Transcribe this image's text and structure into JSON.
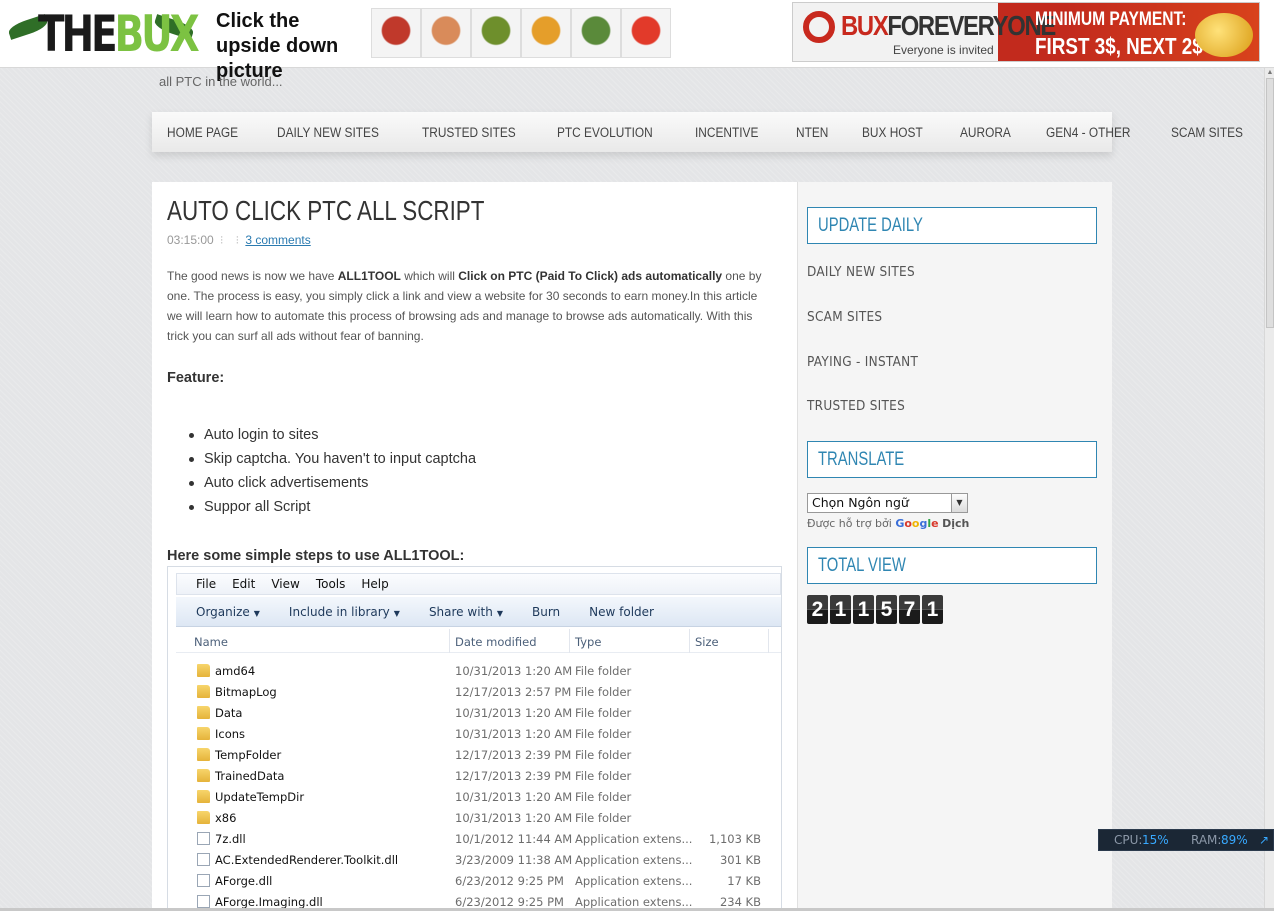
{
  "ad_bar": {
    "logo_text_prefix": "THE",
    "logo_text_suffix": "BUX",
    "promo_text": "Click the upside down picture",
    "thumbnails": [
      "ghostbusters-icon",
      "warrior-woman-icon",
      "shrek-icon",
      "linux-penguin-icon",
      "sheep-icon",
      "kfc-colonel-icon"
    ],
    "thumb_colors": [
      "#c0392b",
      "#d98b5a",
      "#6e8f2c",
      "#e59e2a",
      "#5a8a3a",
      "#e23a2a"
    ],
    "banner": {
      "name_prefix": "BUX",
      "name_suffix": "FOREVERYONE",
      "subtitle": "Everyone is invited",
      "payment_line1": "MINIMUM PAYMENT:",
      "payment_line2": "FIRST 3$, NEXT 2$"
    }
  },
  "tagline": "all PTC in the world...",
  "nav": {
    "items": [
      "HOME PAGE",
      "DAILY NEW SITES",
      "TRUSTED SITES",
      "PTC EVOLUTION",
      "INCENTIVE",
      "NTEN",
      "BUX HOST",
      "AURORA",
      "GEN4 - OTHER",
      "SCAM SITES"
    ]
  },
  "post": {
    "title": "AUTO CLICK PTC ALL SCRIPT",
    "time": "03:15:00",
    "comments": "3 comments",
    "intro_1": "The good news is now we have ",
    "intro_tool": "ALL1TOOL",
    "intro_2": " which will ",
    "intro_bold": "Click on PTC (Paid To Click) ads automatically",
    "intro_3": " one by one. The process is easy, you simply click a link and view a website for 30 seconds to earn money.In this article we will learn how to automate this process of browsing ads and manage to browse ads automatically. With this trick you can surf all ads without fear of banning.",
    "feature_heading": "Feature:",
    "features": [
      "Auto login to sites",
      "Skip captcha. You haven't to input captcha",
      "Auto click advertisements",
      "Suppor all Script"
    ],
    "steps_heading": "Here some simple steps to use ALL1TOOL:"
  },
  "explorer": {
    "menu": [
      "File",
      "Edit",
      "View",
      "Tools",
      "Help"
    ],
    "toolbar": [
      "Organize",
      "Include in library",
      "Share with",
      "Burn",
      "New folder"
    ],
    "columns": [
      "Name",
      "Date modified",
      "Type",
      "Size"
    ],
    "rows": [
      {
        "name": "amd64",
        "date": "10/31/2013 1:20 AM",
        "type": "File folder",
        "size": "",
        "kind": "folder"
      },
      {
        "name": "BitmapLog",
        "date": "12/17/2013 2:57 PM",
        "type": "File folder",
        "size": "",
        "kind": "folder"
      },
      {
        "name": "Data",
        "date": "10/31/2013 1:20 AM",
        "type": "File folder",
        "size": "",
        "kind": "folder"
      },
      {
        "name": "Icons",
        "date": "10/31/2013 1:20 AM",
        "type": "File folder",
        "size": "",
        "kind": "folder"
      },
      {
        "name": "TempFolder",
        "date": "12/17/2013 2:39 PM",
        "type": "File folder",
        "size": "",
        "kind": "folder"
      },
      {
        "name": "TrainedData",
        "date": "12/17/2013 2:39 PM",
        "type": "File folder",
        "size": "",
        "kind": "folder"
      },
      {
        "name": "UpdateTempDir",
        "date": "10/31/2013 1:20 AM",
        "type": "File folder",
        "size": "",
        "kind": "folder"
      },
      {
        "name": "x86",
        "date": "10/31/2013 1:20 AM",
        "type": "File folder",
        "size": "",
        "kind": "folder"
      },
      {
        "name": "7z.dll",
        "date": "10/1/2012 11:44 AM",
        "type": "Application extens...",
        "size": "1,103 KB",
        "kind": "dll"
      },
      {
        "name": "AC.ExtendedRenderer.Toolkit.dll",
        "date": "3/23/2009 11:38 AM",
        "type": "Application extens...",
        "size": "301 KB",
        "kind": "dll"
      },
      {
        "name": "AForge.dll",
        "date": "6/23/2012 9:25 PM",
        "type": "Application extens...",
        "size": "17 KB",
        "kind": "dll"
      },
      {
        "name": "AForge.Imaging.dll",
        "date": "6/23/2012 9:25 PM",
        "type": "Application extens...",
        "size": "234 KB",
        "kind": "dll"
      }
    ]
  },
  "sidebar": {
    "update_title": "UPDATE DAILY",
    "links": [
      "DAILY NEW SITES",
      "SCAM SITES",
      "PAYING - INSTANT",
      "TRUSTED SITES"
    ],
    "translate_title": "TRANSLATE",
    "language_select": "Chọn Ngôn ngữ",
    "powered_prefix": "Được hỗ trợ bởi",
    "powered_google": "Google",
    "powered_suffix": "Dịch",
    "total_title": "TOTAL VIEW",
    "counter": [
      "2",
      "1",
      "1",
      "5",
      "7",
      "1"
    ]
  },
  "system_bar": {
    "cpu_label": "CPU:",
    "cpu_value": "15%",
    "ram_label": "RAM:",
    "ram_value": "89%"
  },
  "colors": {
    "accent": "#2f86b2",
    "link": "#2a7ab0",
    "sysbar_value": "#38a9ff"
  }
}
